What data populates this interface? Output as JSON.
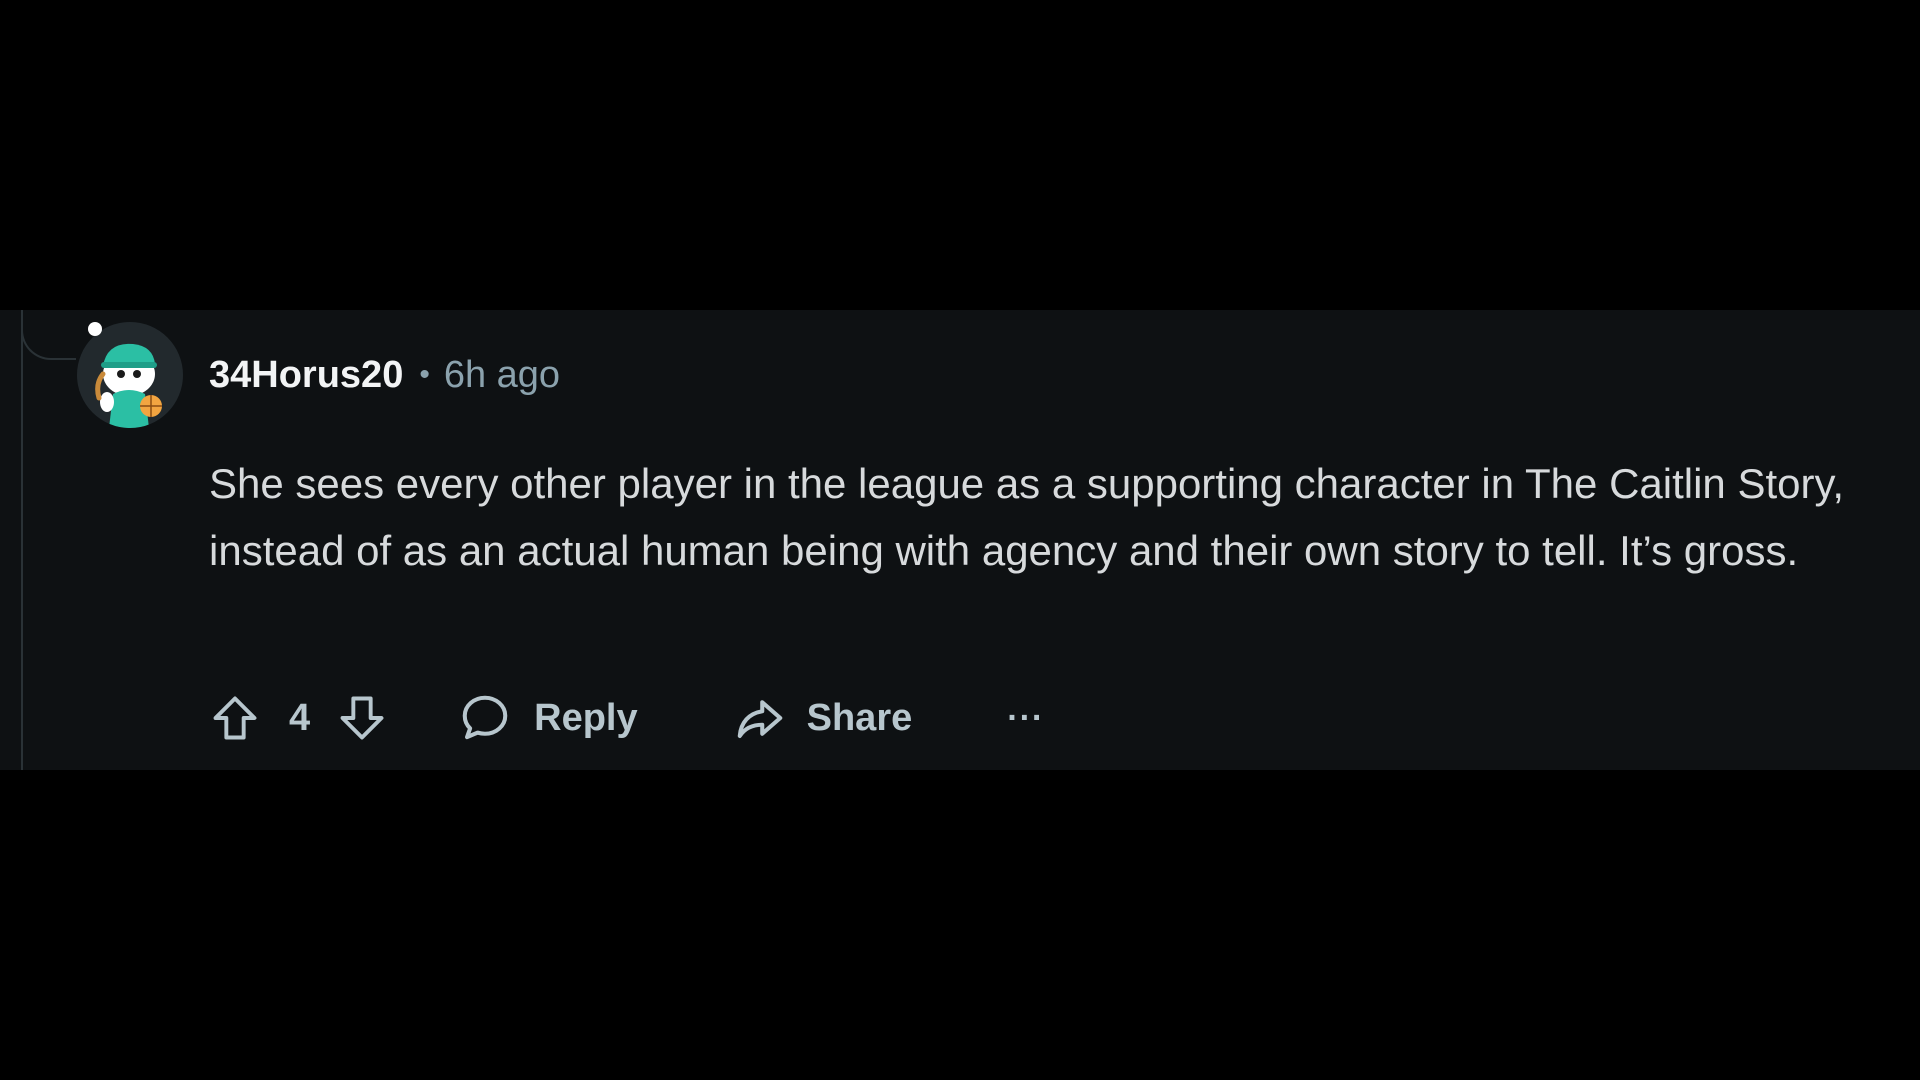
{
  "comment": {
    "author": "34Horus20",
    "separator": "•",
    "timestamp": "6h ago",
    "avatar_icon": "snoo-avatar-icon",
    "online_indicator": true,
    "body": "She sees every other player in the league as a supporting character in The Caitlin Story, instead of as an actual human being with agency and their own story to tell. It’s gross.",
    "actions": {
      "upvote_icon": "upvote-arrow-icon",
      "score": "4",
      "downvote_icon": "downvote-arrow-icon",
      "reply_icon": "speech-bubble-icon",
      "reply_label": "Reply",
      "share_icon": "share-arrow-icon",
      "share_label": "Share",
      "more_label": "···"
    }
  },
  "colors": {
    "page_background": "#000000",
    "panel_background": "#0e1113",
    "username": "#f2f4f5",
    "meta_text": "#8ba2ad",
    "body_text": "#d7dadc",
    "action_text": "#b7c6cd",
    "thread_line": "#2a3236",
    "avatar_accent": "#2bbfa4"
  }
}
